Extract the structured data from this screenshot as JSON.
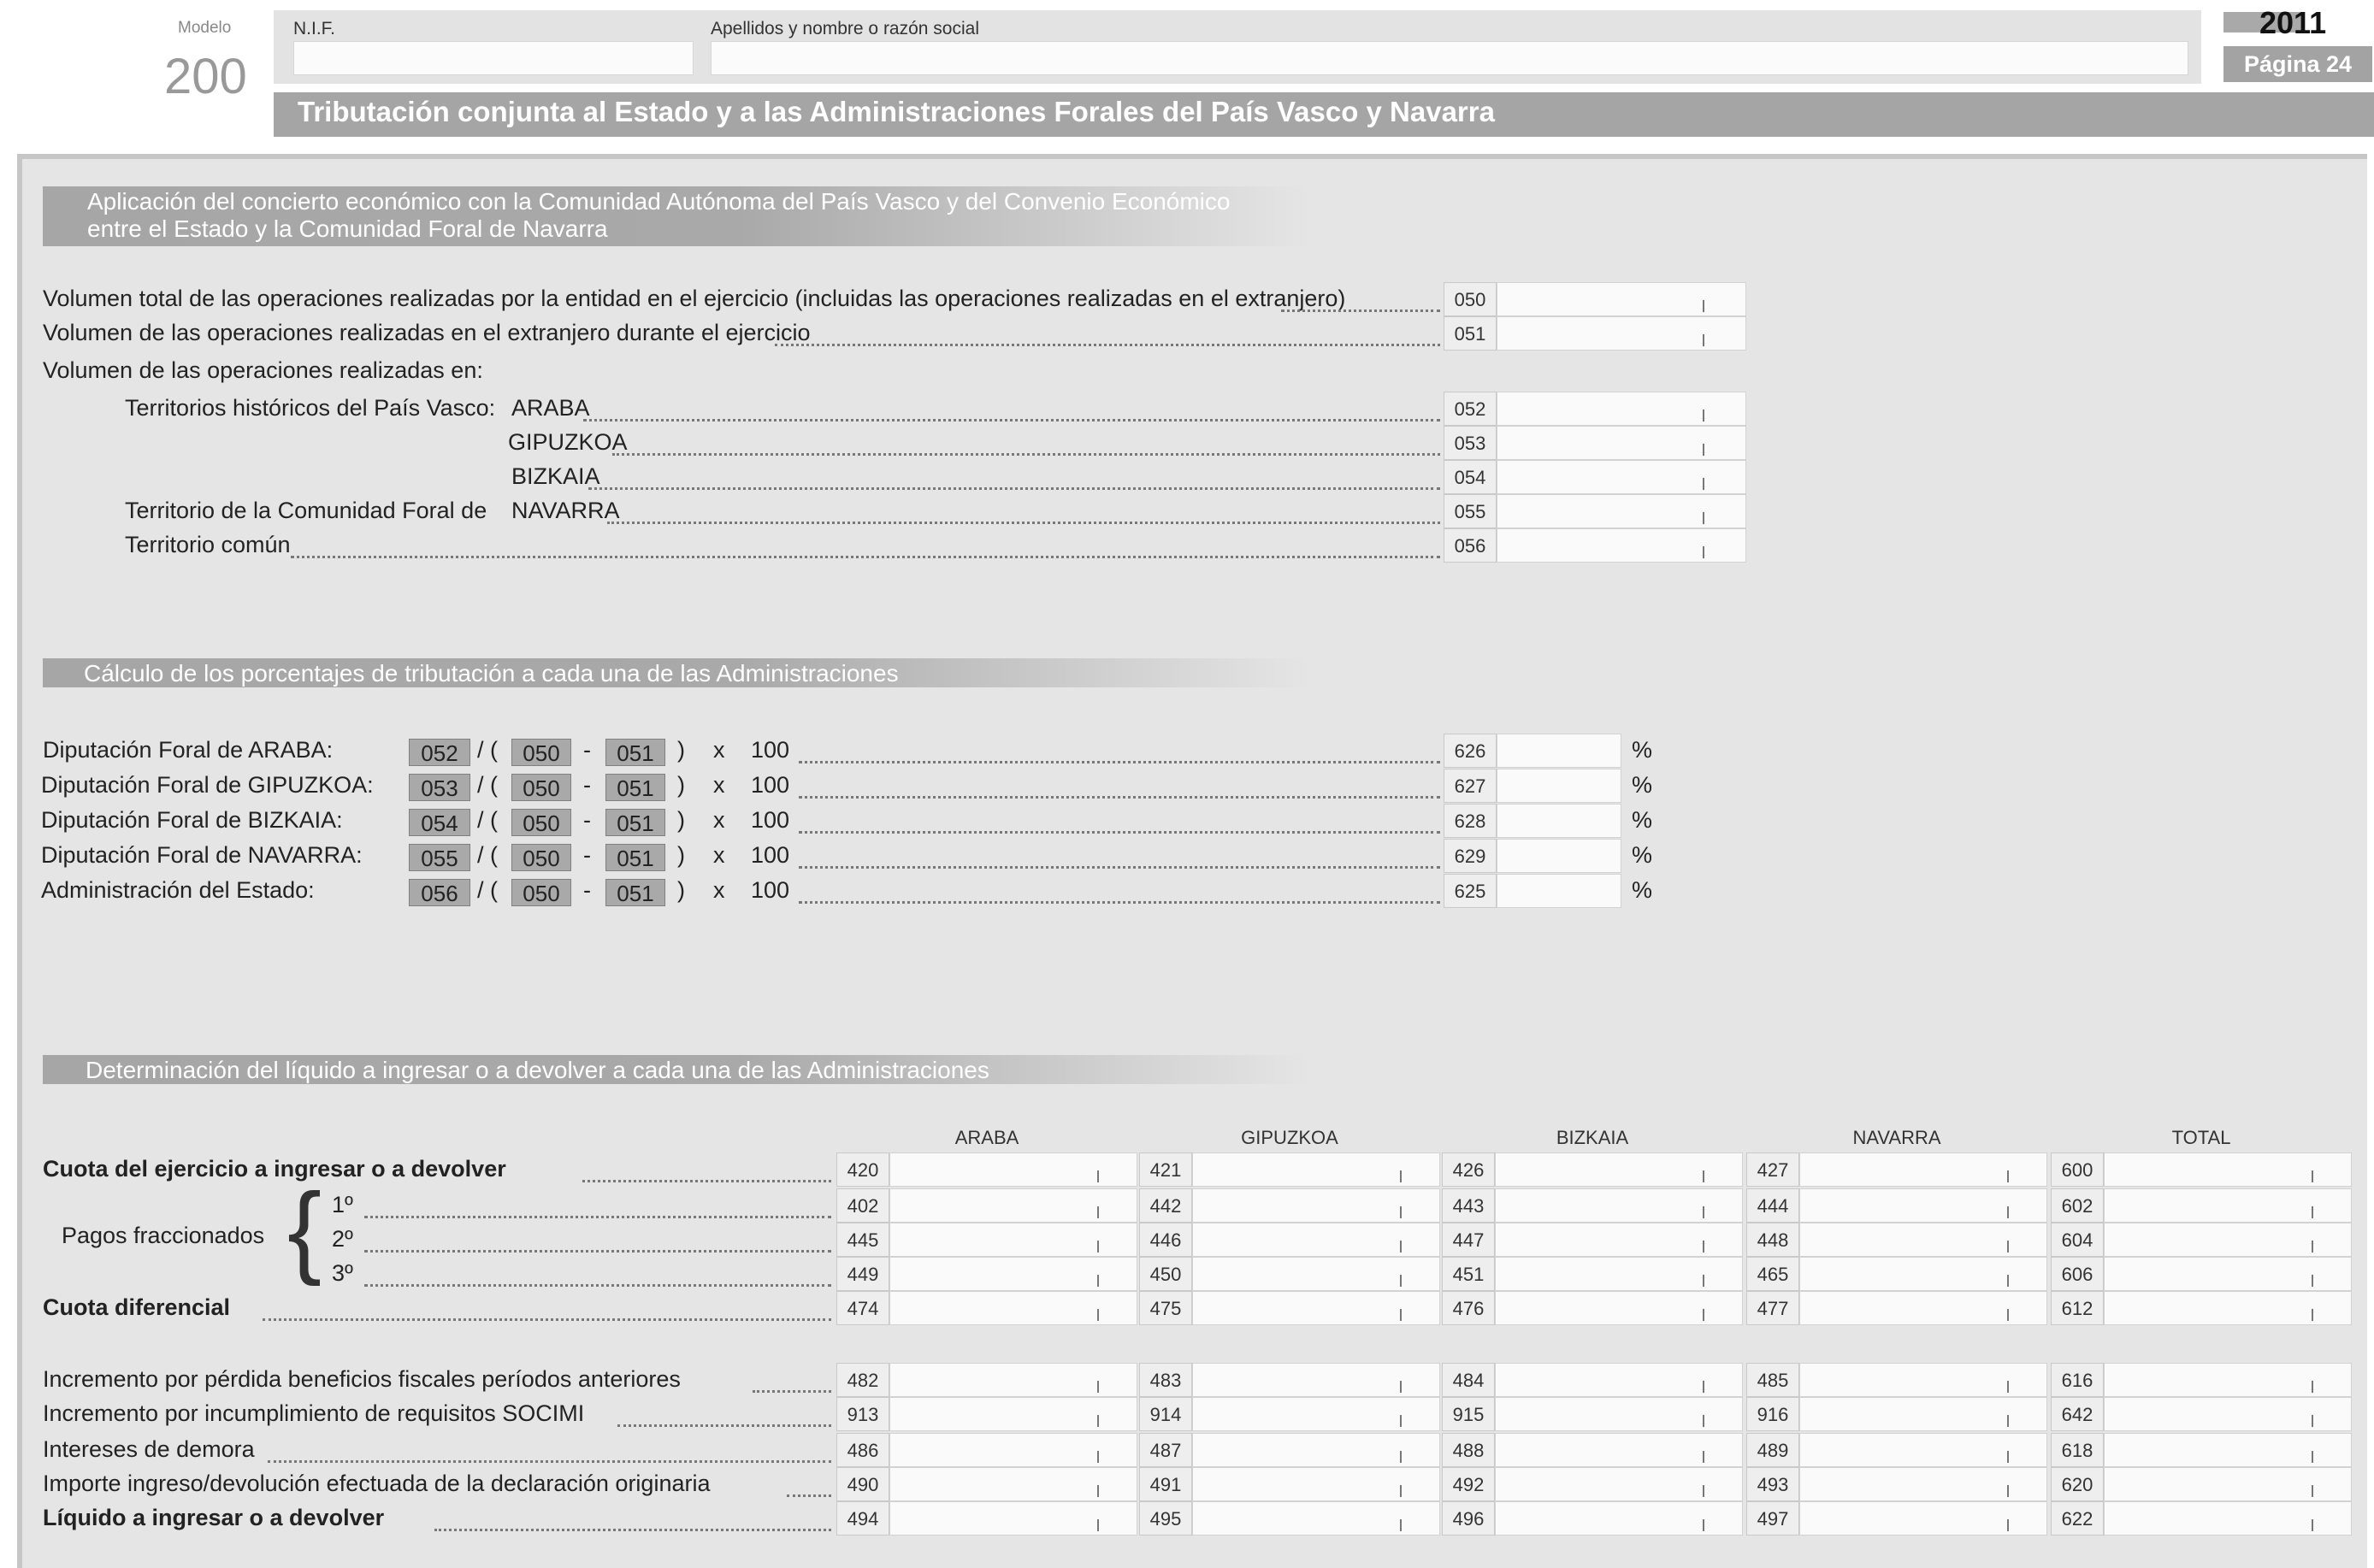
{
  "header": {
    "modelo_label": "Modelo",
    "modelo_number": "200",
    "nif_label": "N.I.F.",
    "nombre_label": "Apellidos y nombre o razón social",
    "year": "2011",
    "page": "Página 24",
    "title": "Tributación conjunta al Estado y a las Administraciones Forales del País Vasco y Navarra"
  },
  "section1": {
    "title_line1": "Aplicación del concierto económico con la Comunidad Autónoma del País Vasco y del Convenio Económico",
    "title_line2": "entre el Estado y la Comunidad Foral de Navarra",
    "vol_total": "Volumen total de las operaciones realizadas por la entidad en el ejercicio (incluidas las operaciones realizadas en el extranjero)",
    "vol_extranjero": "Volumen de las operaciones realizadas en el extranjero durante el ejercicio",
    "vol_en": "Volumen de las operaciones realizadas en:",
    "territorios_pv": "Territorios históricos del País Vasco:",
    "araba": "ARABA",
    "gipuzkoa": "GIPUZKOA",
    "bizkaia": "BIZKAIA",
    "territorio_foral": "Territorio de la Comunidad Foral  de",
    "navarra": "NAVARRA",
    "territorio_comun": "Territorio común",
    "codes": [
      "050",
      "051",
      "052",
      "053",
      "054",
      "055",
      "056"
    ]
  },
  "section2": {
    "title": "Cálculo de los porcentajes de tributación a cada una de las Administraciones",
    "rows": [
      {
        "label": "Diputación Foral de ARABA:",
        "num": "052",
        "a": "050",
        "b": "051",
        "mult": "100",
        "code": "626"
      },
      {
        "label": "Diputación Foral de GIPUZKOA:",
        "num": "053",
        "a": "050",
        "b": "051",
        "mult": "100",
        "code": "627"
      },
      {
        "label": "Diputación Foral de BIZKAIA:",
        "num": "054",
        "a": "050",
        "b": "051",
        "mult": "100",
        "code": "628"
      },
      {
        "label": "Diputación Foral de NAVARRA:",
        "num": "055",
        "a": "050",
        "b": "051",
        "mult": "100",
        "code": "629"
      },
      {
        "label": "Administración del Estado:",
        "num": "056",
        "a": "050",
        "b": "051",
        "mult": "100",
        "code": "625"
      }
    ],
    "slash": "/ (",
    "minus": "-",
    "close": ")",
    "times": "x",
    "percent": "%"
  },
  "section3": {
    "title": "Determinación del líquido a ingresar o a devolver a cada una de las Administraciones",
    "columns": [
      "ARABA",
      "GIPUZKOA",
      "BIZKAIA",
      "NAVARRA",
      "TOTAL"
    ],
    "pagos_label": "Pagos fraccionados",
    "rows": [
      {
        "label": "Cuota del ejercicio a ingresar o a devolver",
        "bold": true,
        "codes": [
          "420",
          "421",
          "426",
          "427",
          "600"
        ]
      },
      {
        "label": "1º",
        "codes": [
          "402",
          "442",
          "443",
          "444",
          "602"
        ]
      },
      {
        "label": "2º",
        "codes": [
          "445",
          "446",
          "447",
          "448",
          "604"
        ]
      },
      {
        "label": "3º",
        "codes": [
          "449",
          "450",
          "451",
          "465",
          "606"
        ]
      },
      {
        "label": "Cuota diferencial",
        "bold": true,
        "codes": [
          "474",
          "475",
          "476",
          "477",
          "612"
        ]
      },
      {
        "label": "Incremento por pérdida beneficios fiscales períodos anteriores",
        "codes": [
          "482",
          "483",
          "484",
          "485",
          "616"
        ]
      },
      {
        "label": "Incremento por incumplimiento de requisitos SOCIMI",
        "codes": [
          "913",
          "914",
          "915",
          "916",
          "642"
        ]
      },
      {
        "label": "Intereses de demora",
        "codes": [
          "486",
          "487",
          "488",
          "489",
          "618"
        ]
      },
      {
        "label": "Importe ingreso/devolución efectuada de la declaración originaria",
        "codes": [
          "490",
          "491",
          "492",
          "493",
          "620"
        ]
      },
      {
        "label": "Líquido a ingresar o a devolver",
        "bold": true,
        "codes": [
          "494",
          "495",
          "496",
          "497",
          "622"
        ]
      }
    ]
  }
}
